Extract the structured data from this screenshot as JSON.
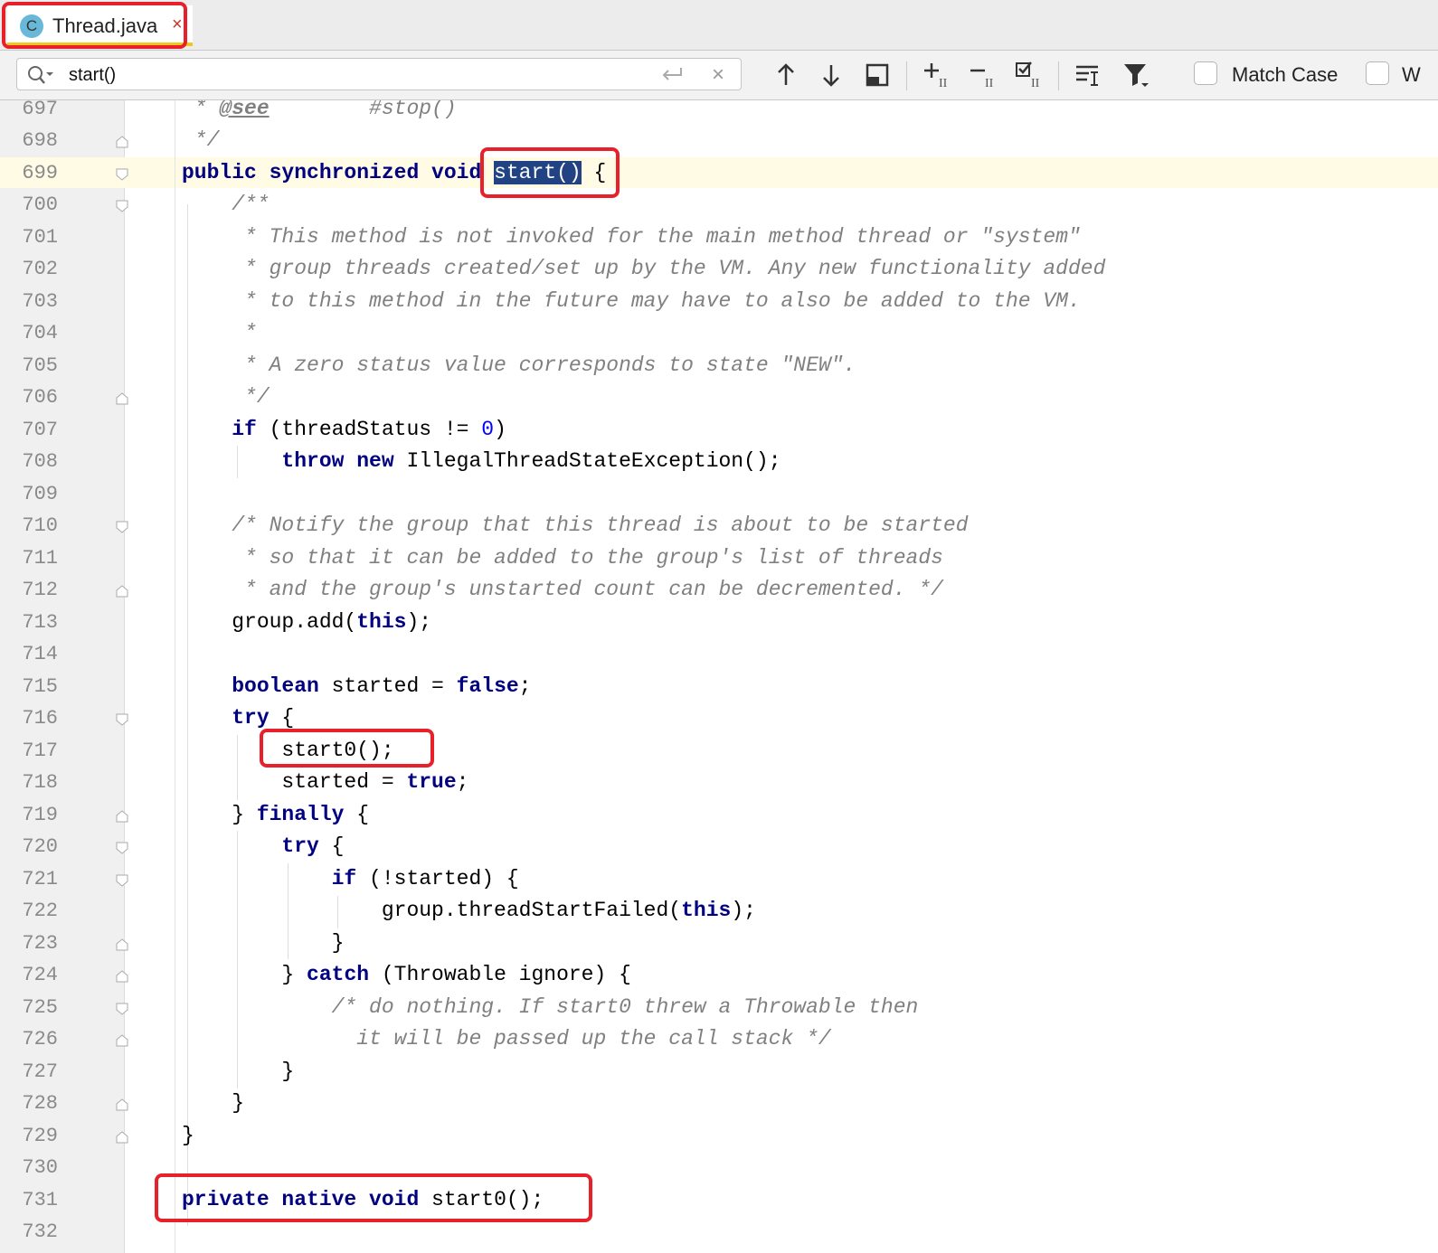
{
  "tab": {
    "label": "Thread.java",
    "icon_letter": "C",
    "close_glyph": "×"
  },
  "find": {
    "query": "start()",
    "clear_glyph": "×",
    "match_case_label": "Match Case",
    "words_label_partial": "W"
  },
  "editor": {
    "lines": [
      {
        "n": "697"
      },
      {
        "n": "698"
      },
      {
        "n": "699"
      },
      {
        "n": "700"
      },
      {
        "n": "701"
      },
      {
        "n": "702"
      },
      {
        "n": "703"
      },
      {
        "n": "704"
      },
      {
        "n": "705"
      },
      {
        "n": "706"
      },
      {
        "n": "707"
      },
      {
        "n": "708"
      },
      {
        "n": "709"
      },
      {
        "n": "710"
      },
      {
        "n": "711"
      },
      {
        "n": "712"
      },
      {
        "n": "713"
      },
      {
        "n": "714"
      },
      {
        "n": "715"
      },
      {
        "n": "716"
      },
      {
        "n": "717"
      },
      {
        "n": "718"
      },
      {
        "n": "719"
      },
      {
        "n": "720"
      },
      {
        "n": "721"
      },
      {
        "n": "722"
      },
      {
        "n": "723"
      },
      {
        "n": "724"
      },
      {
        "n": "725"
      },
      {
        "n": "726"
      },
      {
        "n": "727"
      },
      {
        "n": "728"
      },
      {
        "n": "729"
      },
      {
        "n": "730"
      },
      {
        "n": "731"
      },
      {
        "n": "732"
      }
    ],
    "code": {
      "l697_a": " * ",
      "l697_tag": "@see",
      "l697_b": "        #stop()",
      "l698": " */",
      "l699_kw": "public synchronized void ",
      "l699_sel": "start()",
      "l699_rest": " {",
      "l700": "    /**",
      "l701": "     * This method is not invoked for the main method thread or \"system\"",
      "l702": "     * group threads created/set up by the VM. Any new functionality added",
      "l703": "     * to this method in the future may have to also be added to the VM.",
      "l704": "     *",
      "l705": "     * A zero status value corresponds to state \"NEW\".",
      "l706": "     */",
      "l707_kw": "    if",
      "l707_a": " (threadStatus != ",
      "l707_num": "0",
      "l707_b": ")",
      "l708_kw": "        throw new",
      "l708_rest": " IllegalThreadStateException();",
      "l710": "    /* Notify the group that this thread is about to be started",
      "l711": "     * so that it can be added to the group's list of threads",
      "l712": "     * and the group's unstarted count can be decremented. */",
      "l713_a": "    group.add(",
      "l713_kw": "this",
      "l713_b": ");",
      "l715_kw": "    boolean",
      "l715_a": " started = ",
      "l715_kw2": "false",
      "l715_b": ";",
      "l716_kw": "    try",
      "l716_rest": " {",
      "l717": "        start0();",
      "l718_a": "        started = ",
      "l718_kw": "true",
      "l718_b": ";",
      "l719_a": "    } ",
      "l719_kw": "finally",
      "l719_b": " {",
      "l720_kw": "        try",
      "l720_rest": " {",
      "l721_kw": "            if",
      "l721_rest": " (!started) {",
      "l722_a": "                group.threadStartFailed(",
      "l722_kw": "this",
      "l722_b": ");",
      "l723": "            }",
      "l724_a": "        } ",
      "l724_kw": "catch",
      "l724_b": " (Throwable ignore) {",
      "l725": "            /* do nothing. If start0 threw a Throwable then",
      "l726": "              it will be passed up the call stack */",
      "l727": "        }",
      "l728": "    }",
      "l729": "}",
      "l731_kw": "private native void",
      "l731_rest": " start0();"
    }
  }
}
